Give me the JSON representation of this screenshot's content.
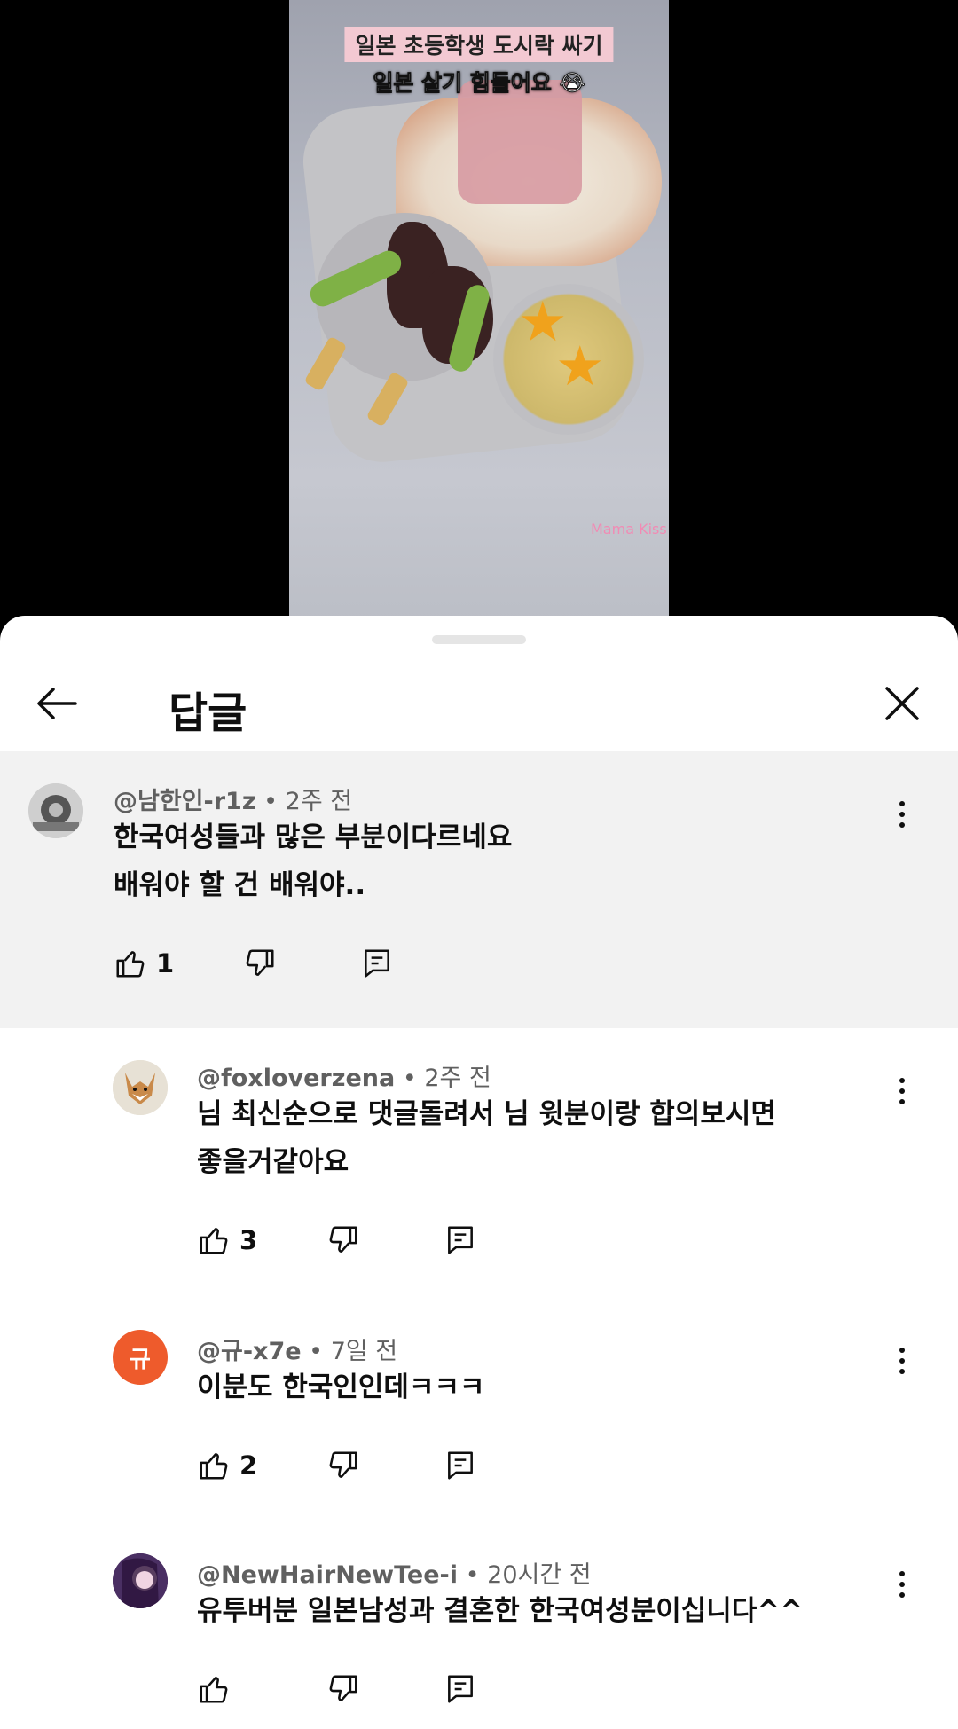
{
  "video": {
    "caption_line1": "일본 초등학생 도시락 싸기",
    "caption_line2": "일본 살기 힘들어요 😭",
    "watermark": "Mama Kiss"
  },
  "sheet": {
    "title": "답글"
  },
  "parent_comment": {
    "author": "@남한인-r1z",
    "time": "2주 전",
    "lines": [
      "한국여성들과 많은 부분이다르네요",
      "배워야 할 건 배워야.."
    ],
    "likes": "1"
  },
  "replies": [
    {
      "author": "@foxloverzena",
      "time": "2주 전",
      "lines": [
        "님 최신순으로 댓글돌려서 님 윗분이랑 합의보시면",
        "좋을거같아요"
      ],
      "likes": "3",
      "avatar_color": "#e7e1d5"
    },
    {
      "author": "@규-x7e",
      "time": "7일 전",
      "lines": [
        "이분도 한국인인데ㅋㅋㅋ"
      ],
      "likes": "2",
      "avatar_letter": "규",
      "avatar_color": "#ee5b2c"
    },
    {
      "author": "@NewHairNewTee-i",
      "time": "20시간 전",
      "lines": [
        "유투버분 일본남성과 결혼한 한국여성분이십니다^^"
      ],
      "likes": "",
      "avatar_color": "#5b3a72"
    }
  ],
  "separator": "•",
  "icons": {
    "back": "arrow-left-icon",
    "close": "close-icon",
    "more": "more-vert-icon",
    "like": "thumb-up-icon",
    "dislike": "thumb-down-icon",
    "reply": "comment-reply-icon"
  }
}
